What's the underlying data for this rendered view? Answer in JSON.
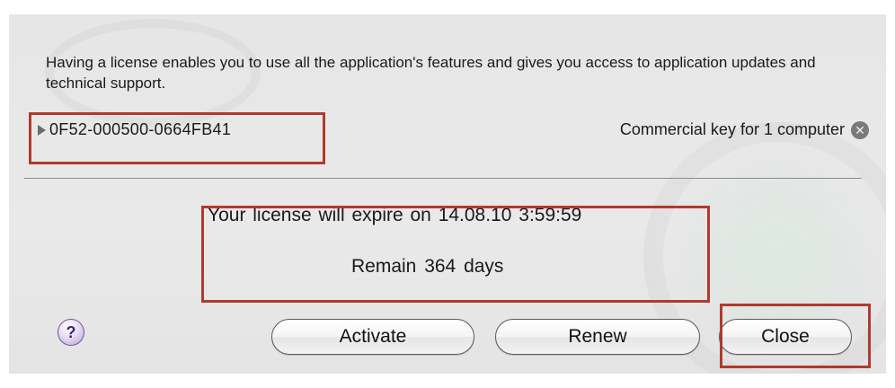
{
  "dialog": {
    "intro_text": "Having a license enables you to use all the application's features and gives you access to application updates and technical support.",
    "license_key": "0F52-000500-0664FB41",
    "key_type": "Commercial key for 1 computer",
    "expire_text": "Your license will expire on 14.08.10 3:59:59",
    "remain_text": "Remain 364 days",
    "help_label": "?",
    "buttons": {
      "activate": "Activate",
      "renew": "Renew",
      "close": "Close"
    },
    "remove_icon_glyph": "✕"
  },
  "colors": {
    "highlight": "#b03a2e",
    "background": "#e6e6e6"
  }
}
